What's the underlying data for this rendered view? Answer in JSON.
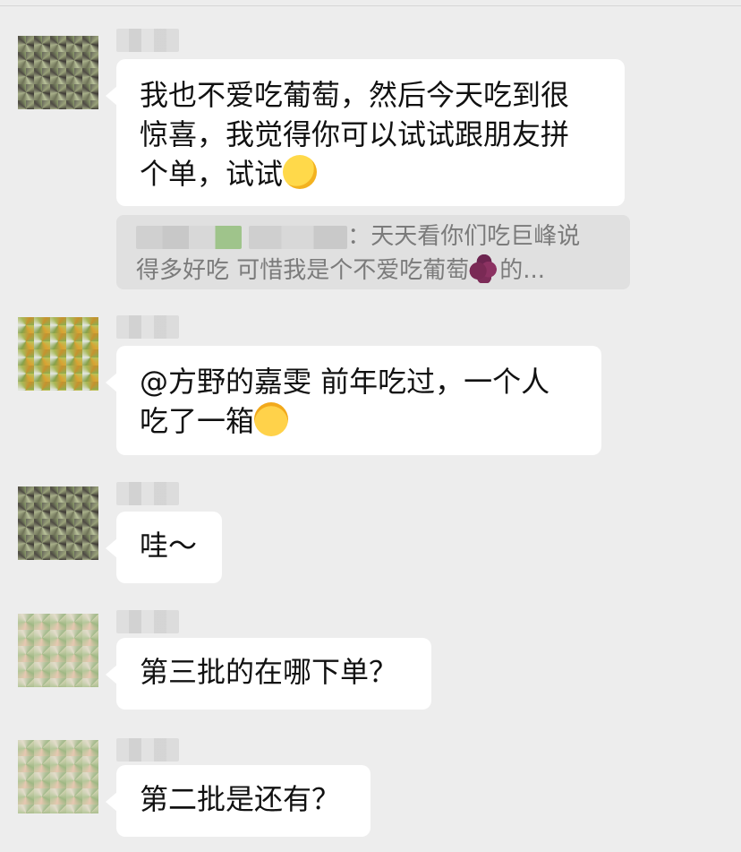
{
  "messages": [
    {
      "id": "m1",
      "text": "我也不爱吃葡萄，然后今天吃到很惊喜，我觉得你可以试试跟朋友拼个单，试试",
      "lines": [
        "我也不爱吃葡萄，然后今天吃到很",
        "惊喜，我觉得你可以试试跟朋友拼",
        "个单，试试"
      ],
      "emoji": "thinking-face-icon",
      "quote": {
        "separator": "：",
        "line1": "天天看你们吃巨峰说",
        "line2a": "得多好吃 可惜我是个不爱吃葡萄",
        "emoji": "grapes-icon",
        "line2b": "的..."
      }
    },
    {
      "id": "m2",
      "lines": [
        "@方野的嘉雯 前年吃过，一个人",
        "吃了一箱"
      ],
      "emoji": "tears-of-joy-icon"
    },
    {
      "id": "m3",
      "lines": [
        "哇～"
      ]
    },
    {
      "id": "m4",
      "lines": [
        "第三批的在哪下单？"
      ]
    },
    {
      "id": "m5",
      "lines": [
        "第二批是还有？"
      ]
    }
  ],
  "colors": {
    "background": "#ededed",
    "bubble": "#ffffff",
    "quote_bg": "#e0e0e0",
    "quote_text": "#7b7b7b"
  }
}
